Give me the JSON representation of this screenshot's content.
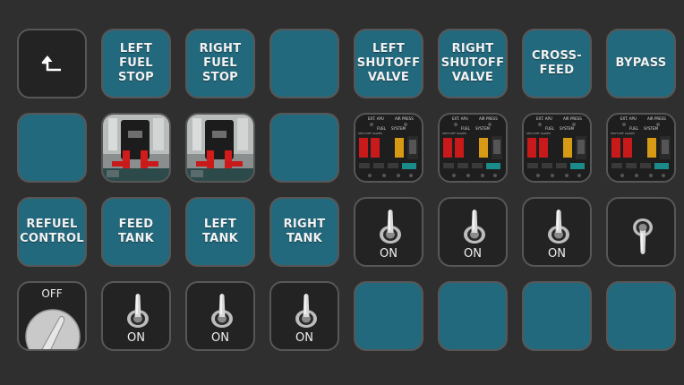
{
  "row1": [
    {
      "name": "back-button",
      "icon": "back-arrow-icon"
    },
    {
      "name": "left-fuel-stop-button",
      "label": "LEFT\nFUEL\nSTOP"
    },
    {
      "name": "right-fuel-stop-button",
      "label": "RIGHT\nFUEL\nSTOP"
    },
    {
      "name": "blank-key-r1c4"
    },
    {
      "name": "left-shutoff-valve-button",
      "label": "LEFT\nSHUTOFF\nVALVE"
    },
    {
      "name": "right-shutoff-valve-button",
      "label": "RIGHT\nSHUTOFF\nVALVE"
    },
    {
      "name": "crossfeed-button",
      "label": "CROSS-\nFEED"
    },
    {
      "name": "bypass-button",
      "label": "BYPASS"
    }
  ],
  "fuel_panel": {
    "header_left": "EXT. APU",
    "header_right": "AIR PRESS",
    "fuel_label": "FUEL",
    "system_label": "SYSTEM",
    "valve_text": "SHUT-OFF VALVES",
    "left_text": "LEFT",
    "right_text": "RIGHT",
    "cross_text": "CROSS FEED",
    "bypass_text": "BYPASS",
    "colors": {
      "red": "#c81a1a",
      "amber": "#d79a14",
      "teal": "#1a8a8a"
    }
  },
  "row3": [
    {
      "name": "refuel-control-button",
      "label": "REFUEL\nCONTROL"
    },
    {
      "name": "feed-tank-button",
      "label": "FEED\nTANK"
    },
    {
      "name": "left-tank-button",
      "label": "LEFT\nTANK"
    },
    {
      "name": "right-tank-button",
      "label": "RIGHT\nTANK"
    }
  ],
  "switches": {
    "row3_on": [
      "ON",
      "ON",
      "ON"
    ],
    "row4_on": [
      "ON",
      "ON",
      "ON"
    ]
  },
  "knob": {
    "off_label": "OFF"
  },
  "colors": {
    "key_teal": "#23697d",
    "key_dark": "#232323",
    "background": "#2f2f2f"
  }
}
